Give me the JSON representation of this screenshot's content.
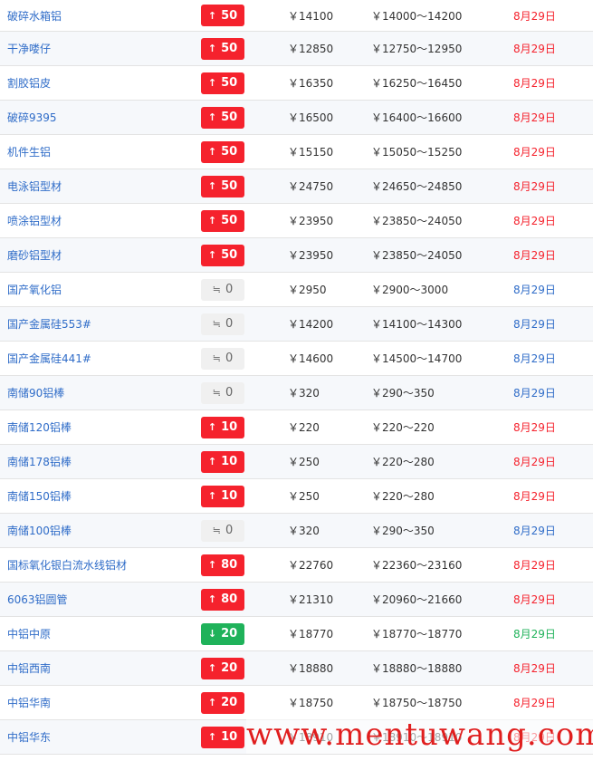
{
  "colors": {
    "up": "#f5222d",
    "down": "#1fb25a",
    "flat_bg": "#f0f0f0",
    "name": "#2f6cc8"
  },
  "icons": {
    "up": "arrow-up-icon",
    "down": "arrow-down-icon",
    "flat": "approx-equal-icon"
  },
  "rows": [
    {
      "name": "破碎水箱铝",
      "dir": "up",
      "arrow": "↑",
      "change": "50",
      "price": "￥14100",
      "range": "￥14000～14200",
      "date": "8月29日"
    },
    {
      "name": "干净喽仔",
      "dir": "up",
      "arrow": "↑",
      "change": "50",
      "price": "￥12850",
      "range": "￥12750～12950",
      "date": "8月29日"
    },
    {
      "name": "割胶铝皮",
      "dir": "up",
      "arrow": "↑",
      "change": "50",
      "price": "￥16350",
      "range": "￥16250～16450",
      "date": "8月29日"
    },
    {
      "name": "破碎9395",
      "dir": "up",
      "arrow": "↑",
      "change": "50",
      "price": "￥16500",
      "range": "￥16400～16600",
      "date": "8月29日"
    },
    {
      "name": "机件生铝",
      "dir": "up",
      "arrow": "↑",
      "change": "50",
      "price": "￥15150",
      "range": "￥15050～15250",
      "date": "8月29日"
    },
    {
      "name": "电泳铝型材",
      "dir": "up",
      "arrow": "↑",
      "change": "50",
      "price": "￥24750",
      "range": "￥24650～24850",
      "date": "8月29日"
    },
    {
      "name": "喷涂铝型材",
      "dir": "up",
      "arrow": "↑",
      "change": "50",
      "price": "￥23950",
      "range": "￥23850～24050",
      "date": "8月29日"
    },
    {
      "name": "磨砂铝型材",
      "dir": "up",
      "arrow": "↑",
      "change": "50",
      "price": "￥23950",
      "range": "￥23850～24050",
      "date": "8月29日"
    },
    {
      "name": "国产氧化铝",
      "dir": "flat",
      "arrow": "≒",
      "change": "0",
      "price": "￥2950",
      "range": "￥2900～3000",
      "date": "8月29日"
    },
    {
      "name": "国产金属硅553#",
      "dir": "flat",
      "arrow": "≒",
      "change": "0",
      "price": "￥14200",
      "range": "￥14100～14300",
      "date": "8月29日"
    },
    {
      "name": "国产金属硅441#",
      "dir": "flat",
      "arrow": "≒",
      "change": "0",
      "price": "￥14600",
      "range": "￥14500～14700",
      "date": "8月29日"
    },
    {
      "name": "南储90铝棒",
      "dir": "flat",
      "arrow": "≒",
      "change": "0",
      "price": "￥320",
      "range": "￥290～350",
      "date": "8月29日"
    },
    {
      "name": "南储120铝棒",
      "dir": "up",
      "arrow": "↑",
      "change": "10",
      "price": "￥220",
      "range": "￥220～220",
      "date": "8月29日"
    },
    {
      "name": "南储178铝棒",
      "dir": "up",
      "arrow": "↑",
      "change": "10",
      "price": "￥250",
      "range": "￥220～280",
      "date": "8月29日"
    },
    {
      "name": "南储150铝棒",
      "dir": "up",
      "arrow": "↑",
      "change": "10",
      "price": "￥250",
      "range": "￥220～280",
      "date": "8月29日"
    },
    {
      "name": "南储100铝棒",
      "dir": "flat",
      "arrow": "≒",
      "change": "0",
      "price": "￥320",
      "range": "￥290～350",
      "date": "8月29日"
    },
    {
      "name": "国标氧化银白流水线铝材",
      "dir": "up",
      "arrow": "↑",
      "change": "80",
      "price": "￥22760",
      "range": "￥22360～23160",
      "date": "8月29日"
    },
    {
      "name": "6063铝圆管",
      "dir": "up",
      "arrow": "↑",
      "change": "80",
      "price": "￥21310",
      "range": "￥20960～21660",
      "date": "8月29日"
    },
    {
      "name": "中铝中原",
      "dir": "down",
      "arrow": "↓",
      "change": "20",
      "price": "￥18770",
      "range": "￥18770～18770",
      "date": "8月29日"
    },
    {
      "name": "中铝西南",
      "dir": "up",
      "arrow": "↑",
      "change": "20",
      "price": "￥18880",
      "range": "￥18880～18880",
      "date": "8月29日"
    },
    {
      "name": "中铝华南",
      "dir": "up",
      "arrow": "↑",
      "change": "20",
      "price": "￥18750",
      "range": "￥18750～18750",
      "date": "8月29日"
    },
    {
      "name": "中铝华东",
      "dir": "up",
      "arrow": "↑",
      "change": "10",
      "price": "￥18910",
      "range": "￥18910～18910",
      "date": "8月29日"
    }
  ],
  "watermark": "www.mentuwang.com"
}
